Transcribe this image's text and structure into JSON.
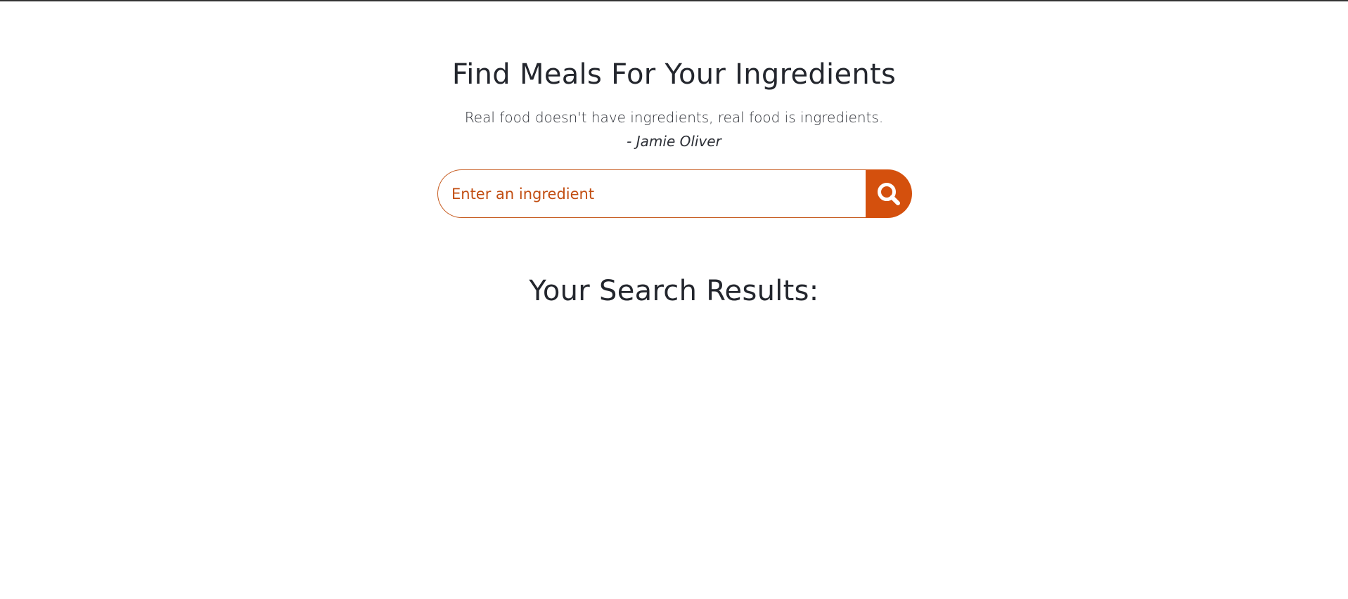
{
  "header": {
    "title": "Find Meals For Your Ingredients",
    "quote": "Real food doesn't have ingredients, real food is ingredients.",
    "quote_author": "- Jamie Oliver"
  },
  "search": {
    "placeholder": "Enter an ingredient",
    "value": "",
    "button_icon": "search-icon"
  },
  "results": {
    "heading": "Your Search Results:",
    "items": []
  },
  "colors": {
    "accent": "#d4500d",
    "input_border": "#c65a1e",
    "placeholder": "#c24e12",
    "heading": "#23262d",
    "top_border": "#333333"
  }
}
